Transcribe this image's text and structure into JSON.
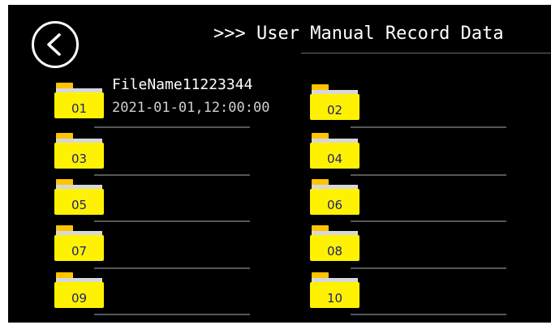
{
  "header": {
    "title": ">>> User Manual Record Data"
  },
  "back_button": {
    "icon": "chevron-left-icon"
  },
  "first_entry": {
    "file_name": "FileName11223344",
    "timestamp": "2021-01-01,12:00:00"
  },
  "folders": [
    "01",
    "02",
    "03",
    "04",
    "05",
    "06",
    "07",
    "08",
    "09",
    "10"
  ],
  "colors": {
    "folder_body": "#fff200",
    "folder_tab": "#ffc400",
    "label": "#1e1e78",
    "background": "#000000"
  }
}
